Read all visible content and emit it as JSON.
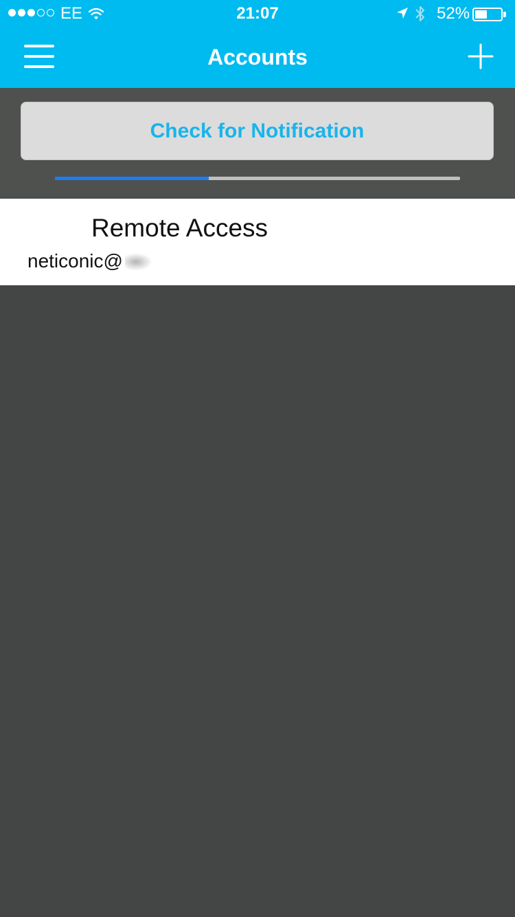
{
  "status_bar": {
    "signal_dots": [
      "filled",
      "filled",
      "filled",
      "empty",
      "empty"
    ],
    "carrier": "EE",
    "wifi_icon": "wifi-icon",
    "time": "21:07",
    "location_icon": "location-arrow-icon",
    "bluetooth_icon": "bluetooth-icon",
    "battery_percent_label": "52%",
    "battery_level": 0.52
  },
  "nav": {
    "title": "Accounts",
    "menu_icon": "hamburger-menu-icon",
    "add_icon": "plus-icon"
  },
  "notification": {
    "button_label": "Check for Notification",
    "progress": 0.38
  },
  "accounts": [
    {
      "name": "Remote Access",
      "email": "neticonic@"
    }
  ],
  "colors": {
    "accent": "#00bbef",
    "button_text": "#19b4eb",
    "progress_fill": "#1a7ef2",
    "background": "#444645"
  }
}
